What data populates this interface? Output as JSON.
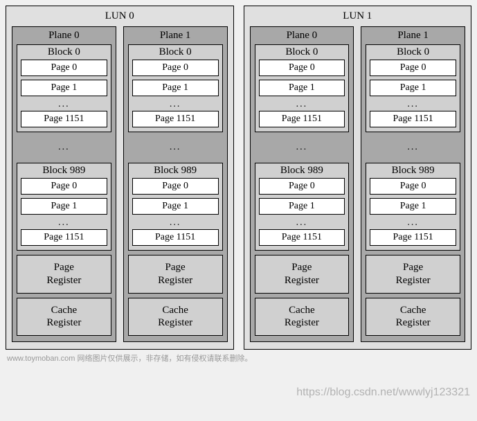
{
  "luns": [
    {
      "title": "LUN 0"
    },
    {
      "title": "LUN 1"
    }
  ],
  "planes": [
    {
      "title": "Plane 0"
    },
    {
      "title": "Plane 1"
    }
  ],
  "blockA": {
    "title": "Block 0",
    "pages": [
      "Page 0",
      "Page 1"
    ],
    "dots": "...",
    "lastPage": "Page 1151"
  },
  "betweenDots": "...",
  "blockB": {
    "title": "Block 989",
    "pages": [
      "Page 0",
      "Page 1"
    ],
    "dots": "...",
    "lastPage": "Page 1151"
  },
  "pageRegister": "Page\nRegister",
  "cacheRegister": "Cache\nRegister",
  "watermarkRight": "https://blog.csdn.net/wwwlyj123321",
  "watermarkBottom": "www.toymoban.com 网络图片仅供展示，非存储，如有侵权请联系删除。"
}
